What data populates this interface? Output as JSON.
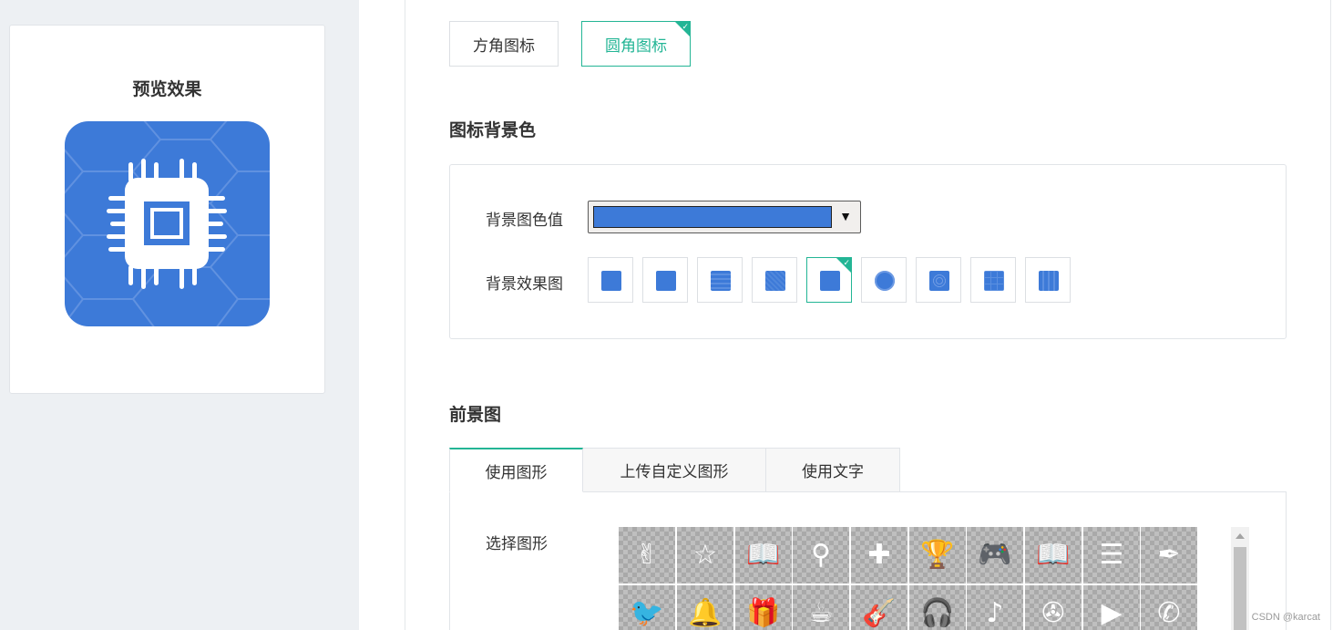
{
  "preview": {
    "title": "预览效果",
    "icon": "cpu-chip-icon",
    "background_color": "#3d7ad8"
  },
  "shape": {
    "options": [
      {
        "label": "方角图标",
        "selected": false
      },
      {
        "label": "圆角图标",
        "selected": true
      }
    ]
  },
  "background": {
    "section_title": "图标背景色",
    "color_label": "背景图色值",
    "color_value": "#3d7ad8",
    "effect_label": "背景效果图",
    "effects": [
      {
        "pattern": "plain",
        "selected": false
      },
      {
        "pattern": "plain",
        "selected": false
      },
      {
        "pattern": "waves",
        "selected": false
      },
      {
        "pattern": "grain",
        "selected": false
      },
      {
        "pattern": "hexagon",
        "selected": true
      },
      {
        "pattern": "flower",
        "selected": false
      },
      {
        "pattern": "circles",
        "selected": false
      },
      {
        "pattern": "grid",
        "selected": false
      },
      {
        "pattern": "stripes",
        "selected": false
      }
    ]
  },
  "foreground": {
    "section_title": "前景图",
    "tabs": [
      {
        "label": "使用图形",
        "active": true
      },
      {
        "label": "上传自定义图形",
        "active": false
      },
      {
        "label": "使用文字",
        "active": false
      }
    ],
    "select_label": "选择图形",
    "icons": [
      {
        "name": "peace-hand-icon",
        "glyph": "✌"
      },
      {
        "name": "star-icon",
        "glyph": "☆"
      },
      {
        "name": "reader-icon",
        "glyph": "📖"
      },
      {
        "name": "tie-icon",
        "glyph": "⚲"
      },
      {
        "name": "puzzle-icon",
        "glyph": "✚"
      },
      {
        "name": "trophy-icon",
        "glyph": "🏆"
      },
      {
        "name": "gamepad-icon",
        "glyph": "🎮"
      },
      {
        "name": "open-book-icon",
        "glyph": "📖"
      },
      {
        "name": "book-stack-icon",
        "glyph": "☰"
      },
      {
        "name": "feather-icon",
        "glyph": "✒"
      },
      {
        "name": "bird-icon",
        "glyph": "🐦"
      },
      {
        "name": "service-bell-icon",
        "glyph": "🔔"
      },
      {
        "name": "gift-icon",
        "glyph": "🎁"
      },
      {
        "name": "coffee-cup-icon",
        "glyph": "☕"
      },
      {
        "name": "guitar-icon",
        "glyph": "🎸"
      },
      {
        "name": "headphones-icon",
        "glyph": "🎧"
      },
      {
        "name": "music-note-icon",
        "glyph": "♪"
      },
      {
        "name": "film-reel-icon",
        "glyph": "✇"
      },
      {
        "name": "play-button-icon",
        "glyph": "▶"
      },
      {
        "name": "phone-icon",
        "glyph": "✆"
      }
    ]
  },
  "colors": {
    "accent": "#23b595",
    "icon_blue": "#3d7ad8"
  },
  "watermark": "CSDN @karcat"
}
